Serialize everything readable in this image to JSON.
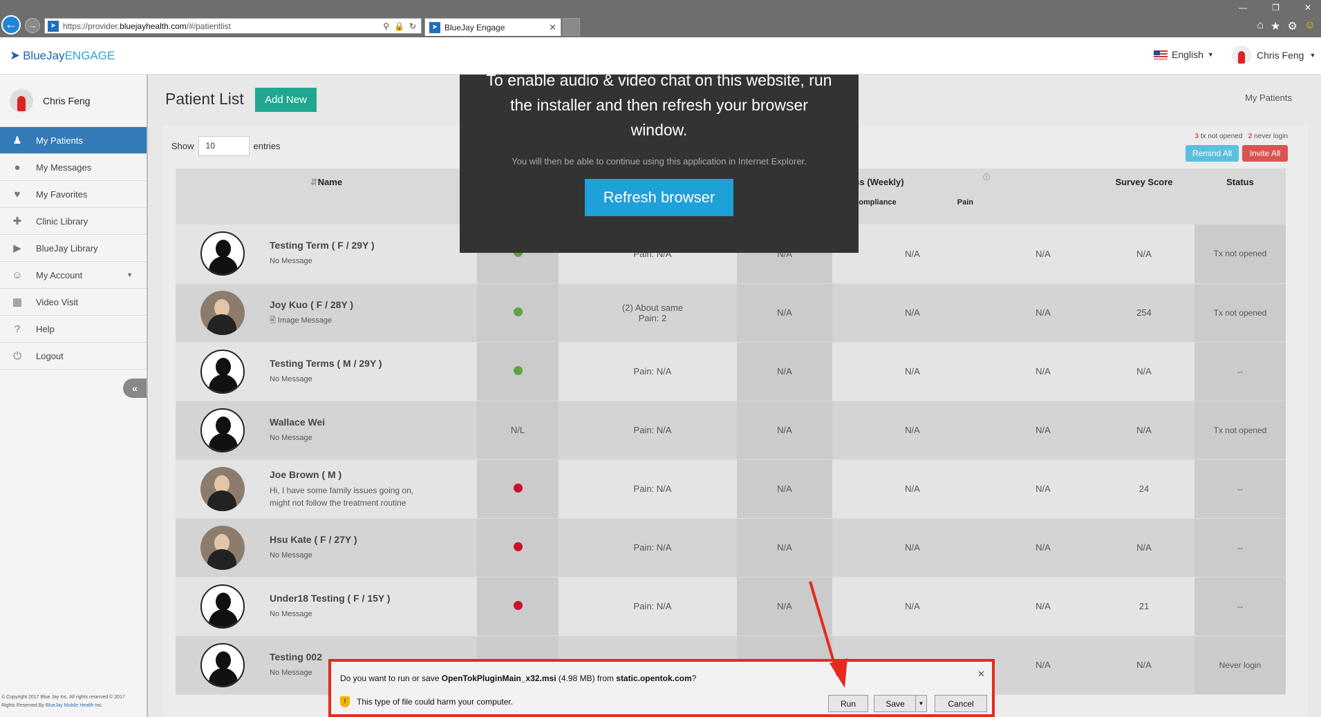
{
  "browser": {
    "url_prefix": "https://provider.",
    "url_domain": "bluejayhealth.com",
    "url_path": "/#/patientlist",
    "tab_title": "BlueJay Engage"
  },
  "header": {
    "logo_blue": "BlueJay",
    "logo_engage": "ENGAGE",
    "language": "English",
    "user_name": "Chris Feng"
  },
  "sidebar": {
    "user_name": "Chris Feng",
    "items": [
      {
        "label": "My Patients",
        "icon": "users-icon"
      },
      {
        "label": "My Messages",
        "icon": "chat-icon"
      },
      {
        "label": "My Favorites",
        "icon": "heart-icon"
      },
      {
        "label": "Clinic Library",
        "icon": "clinic-icon"
      },
      {
        "label": "BlueJay Library",
        "icon": "play-icon"
      },
      {
        "label": "My Account",
        "icon": "account-icon"
      },
      {
        "label": "Video Visit",
        "icon": "calendar-icon"
      },
      {
        "label": "Help",
        "icon": "help-icon"
      },
      {
        "label": "Logout",
        "icon": "power-icon"
      }
    ],
    "copyright_line1": "© Copyright 2017 Blue Jay Inc. All rights reserved © 2017",
    "copyright_line2_prefix": "Rights Reserved By",
    "copyright_company": "BlueJay Mobile Health",
    "copyright_suffix": "Inc."
  },
  "main": {
    "title": "Patient List",
    "add_new": "Add New",
    "breadcrumb": "My Patients",
    "show_label": "Show",
    "show_value": "10",
    "entries_label": "entries",
    "legend_count1": "3",
    "legend_text1": "tx not opened",
    "legend_count2": "2",
    "legend_text2": "never login",
    "remind_all": "Remind All",
    "invite_all": "Invite All"
  },
  "table": {
    "headers": {
      "name": "Name",
      "progress": "Progress (Weekly)",
      "exercise": "Exercise Compliance",
      "pain": "Pain",
      "survey": "Survey Score",
      "status": "Status"
    },
    "rows": [
      {
        "name": "Testing Term ( F / 29Y )",
        "msg": "No Message",
        "dot": "green",
        "dl": "",
        "painTxt": "Pain: N/A",
        "c1": "N/A",
        "ex": "N/A",
        "pain": "N/A",
        "survey": "N/A",
        "status": "Tx not opened",
        "photo": false
      },
      {
        "name": "Joy Kuo ( F / 28Y )",
        "msg": "🖹 Image Message",
        "dot": "green",
        "dl": "",
        "painTxt": "(2) About same\nPain: 2",
        "c1": "N/A",
        "ex": "N/A",
        "pain": "N/A",
        "survey": "254",
        "status": "Tx not opened",
        "photo": true
      },
      {
        "name": "Testing Terms ( M / 29Y )",
        "msg": "No Message",
        "dot": "green",
        "dl": "",
        "painTxt": "Pain: N/A",
        "c1": "N/A",
        "ex": "N/A",
        "pain": "N/A",
        "survey": "N/A",
        "status": "--",
        "photo": false
      },
      {
        "name": "Wallace Wei",
        "msg": "No Message",
        "dot": "",
        "dl": "N/L",
        "painTxt": "Pain: N/A",
        "c1": "N/A",
        "ex": "N/A",
        "pain": "N/A",
        "survey": "N/A",
        "status": "Tx not opened",
        "photo": false
      },
      {
        "name": "Joe Brown ( M )",
        "msg": "Hi, I have some family issues going on, might not follow the treatment routine",
        "dot": "red",
        "dl": "",
        "painTxt": "Pain: N/A",
        "c1": "N/A",
        "ex": "N/A",
        "pain": "N/A",
        "survey": "24",
        "status": "--",
        "photo": true
      },
      {
        "name": "Hsu Kate ( F / 27Y )",
        "msg": "No Message",
        "dot": "red",
        "dl": "",
        "painTxt": "Pain: N/A",
        "c1": "N/A",
        "ex": "N/A",
        "pain": "N/A",
        "survey": "N/A",
        "status": "--",
        "photo": true
      },
      {
        "name": "Under18 Testing ( F / 15Y )",
        "msg": "No Message",
        "dot": "red",
        "dl": "",
        "painTxt": "Pain: N/A",
        "c1": "N/A",
        "ex": "N/A",
        "pain": "N/A",
        "survey": "21",
        "status": "--",
        "photo": false
      },
      {
        "name": "Testing 002",
        "msg": "No Message",
        "dot": "",
        "dl": "",
        "painTxt": "",
        "c1": "",
        "ex": "",
        "pain": "N/A",
        "survey": "N/A",
        "status": "Never login",
        "photo": false
      }
    ]
  },
  "modal": {
    "message": "To enable audio & video chat on this website, run the installer and then refresh your browser window.",
    "sub": "You will then be able to continue using this application in Internet Explorer.",
    "button": "Refresh browser"
  },
  "download_bar": {
    "q1": "Do you want to run or save ",
    "file": "OpenTokPluginMain_x32.msi",
    "size": " (4.98 MB) from ",
    "host": "static.opentok.com",
    "q_end": "?",
    "warning": "This type of file could harm your computer.",
    "run": "Run",
    "save": "Save",
    "cancel": "Cancel"
  },
  "colors": {
    "accent": "#337ab7",
    "add_new": "#1fa88f",
    "refresh": "#1ea0d8",
    "highlight": "#e62a1e"
  }
}
